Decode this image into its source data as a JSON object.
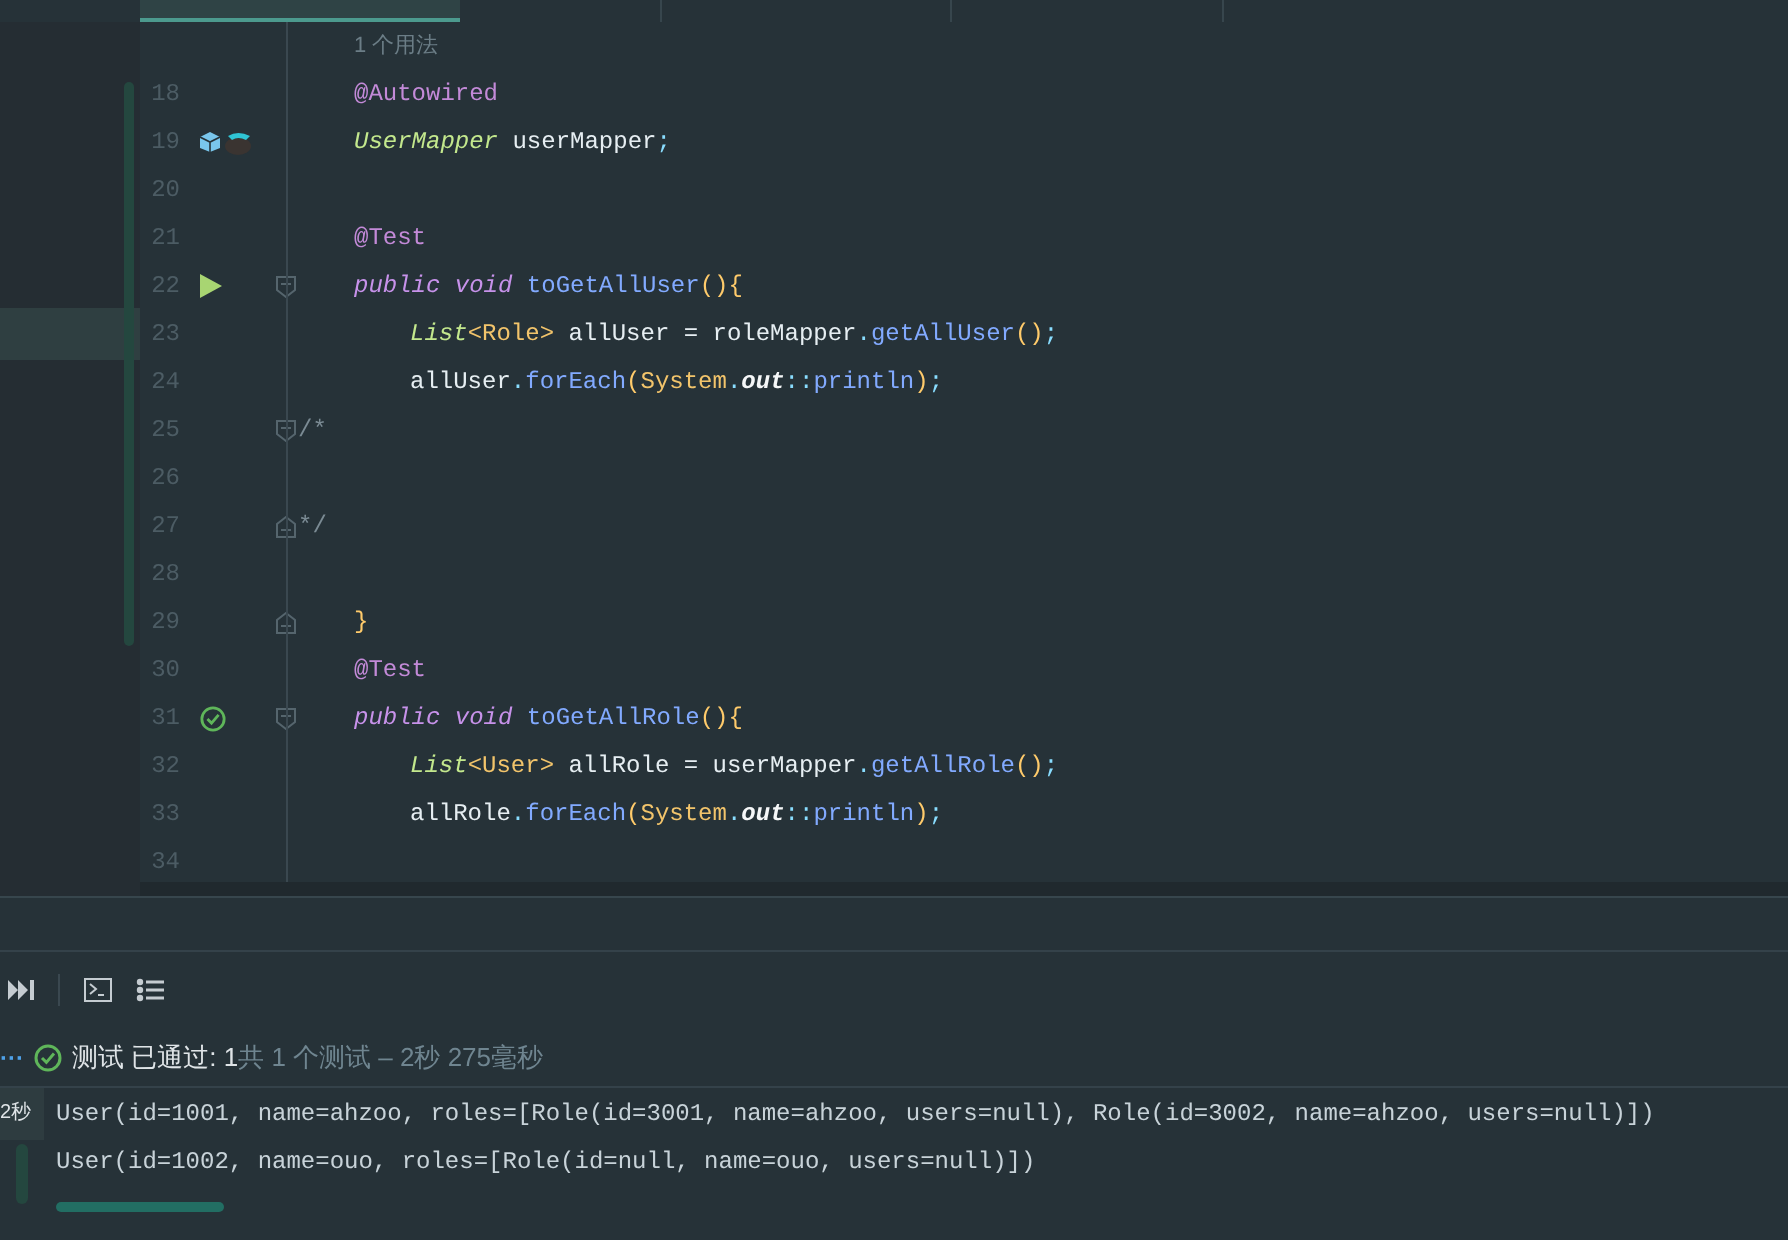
{
  "editor": {
    "usage_hint": "1 个用法",
    "lines": [
      {
        "number": "18",
        "kind": "member",
        "tokens": [
          {
            "text": "@Autowired",
            "kind": "annotation"
          }
        ]
      },
      {
        "number": "19",
        "kind": "member",
        "gutter_icon": {
          "kind": "bean"
        },
        "tokens": [
          {
            "text": "UserMapper",
            "kind": "type"
          },
          {
            "text": " userMapper",
            "kind": "plain"
          },
          {
            "text": ";",
            "kind": "punct"
          }
        ]
      },
      {
        "number": "20"
      },
      {
        "number": "21",
        "kind": "member",
        "tokens": [
          {
            "text": "@Test",
            "kind": "annotation"
          }
        ]
      },
      {
        "number": "22",
        "kind": "member",
        "gutter_icon": {
          "kind": "run"
        },
        "fold_marker": {
          "kind": "start"
        },
        "tokens": [
          {
            "text": "public void",
            "kind": "keyword"
          },
          {
            "text": " toGetAllUser",
            "kind": "method"
          },
          {
            "text": "(){",
            "kind": "paren"
          }
        ]
      },
      {
        "number": "23",
        "kind": "statement",
        "tokens": [
          {
            "text": "List",
            "kind": "type"
          },
          {
            "text": "<Role>",
            "kind": "class"
          },
          {
            "text": " allUser = roleMapper",
            "kind": "plain"
          },
          {
            "text": ".",
            "kind": "punct"
          },
          {
            "text": "getAllUser",
            "kind": "method"
          },
          {
            "text": "()",
            "kind": "paren"
          },
          {
            "text": ";",
            "kind": "punct"
          }
        ]
      },
      {
        "number": "24",
        "kind": "statement",
        "tokens": [
          {
            "text": "allUser",
            "kind": "plain"
          },
          {
            "text": ".",
            "kind": "punct"
          },
          {
            "text": "forEach",
            "kind": "method"
          },
          {
            "text": "(",
            "kind": "paren"
          },
          {
            "text": "System",
            "kind": "class"
          },
          {
            "text": ".",
            "kind": "punct"
          },
          {
            "text": "out",
            "kind": "field"
          },
          {
            "text": "::",
            "kind": "punct"
          },
          {
            "text": "println",
            "kind": "method"
          },
          {
            "text": ")",
            "kind": "paren"
          },
          {
            "text": ";",
            "kind": "punct"
          }
        ]
      },
      {
        "number": "25",
        "kind": "comment",
        "fold_marker": {
          "kind": "start"
        },
        "tokens": [
          {
            "text": "/*",
            "kind": "comment"
          }
        ]
      },
      {
        "number": "26"
      },
      {
        "number": "27",
        "kind": "comment",
        "fold_marker": {
          "kind": "end"
        },
        "tokens": [
          {
            "text": "*/",
            "kind": "comment"
          }
        ]
      },
      {
        "number": "28"
      },
      {
        "number": "29",
        "kind": "member",
        "fold_marker": {
          "kind": "end"
        },
        "tokens": [
          {
            "text": "}",
            "kind": "paren"
          }
        ]
      },
      {
        "number": "30",
        "kind": "member",
        "tokens": [
          {
            "text": "@Test",
            "kind": "annotation"
          }
        ]
      },
      {
        "number": "31",
        "kind": "member",
        "gutter_icon": {
          "kind": "passed"
        },
        "fold_marker": {
          "kind": "start"
        },
        "tokens": [
          {
            "text": "public void",
            "kind": "keyword"
          },
          {
            "text": " toGetAllRole",
            "kind": "method"
          },
          {
            "text": "(){",
            "kind": "paren"
          }
        ]
      },
      {
        "number": "32",
        "kind": "statement",
        "tokens": [
          {
            "text": "List",
            "kind": "type"
          },
          {
            "text": "<User>",
            "kind": "class"
          },
          {
            "text": " allRole = userMapper",
            "kind": "plain"
          },
          {
            "text": ".",
            "kind": "punct"
          },
          {
            "text": "getAllRole",
            "kind": "method"
          },
          {
            "text": "()",
            "kind": "paren"
          },
          {
            "text": ";",
            "kind": "punct"
          }
        ]
      },
      {
        "number": "33",
        "kind": "statement",
        "tokens": [
          {
            "text": "allRole",
            "kind": "plain"
          },
          {
            "text": ".",
            "kind": "punct"
          },
          {
            "text": "forEach",
            "kind": "method"
          },
          {
            "text": "(",
            "kind": "paren"
          },
          {
            "text": "System",
            "kind": "class"
          },
          {
            "text": ".",
            "kind": "punct"
          },
          {
            "text": "out",
            "kind": "field"
          },
          {
            "text": "::",
            "kind": "punct"
          },
          {
            "text": "println",
            "kind": "method"
          },
          {
            "text": ")",
            "kind": "paren"
          },
          {
            "text": ";",
            "kind": "punct"
          }
        ]
      },
      {
        "number": "34"
      }
    ]
  },
  "run_panel": {
    "status": {
      "more": "···",
      "passed_label": "测试 已通过: 1",
      "summary": "共 1 个测试 – 2秒 275毫秒"
    },
    "tree_item": {
      "duration": "2秒"
    },
    "output": [
      "User(id=1001, name=ahzoo, roles=[Role(id=3001, name=ahzoo, users=null), Role(id=3002, name=ahzoo, users=null)])",
      "User(id=1002, name=ouo, roles=[Role(id=null, name=ouo, users=null)])"
    ]
  }
}
